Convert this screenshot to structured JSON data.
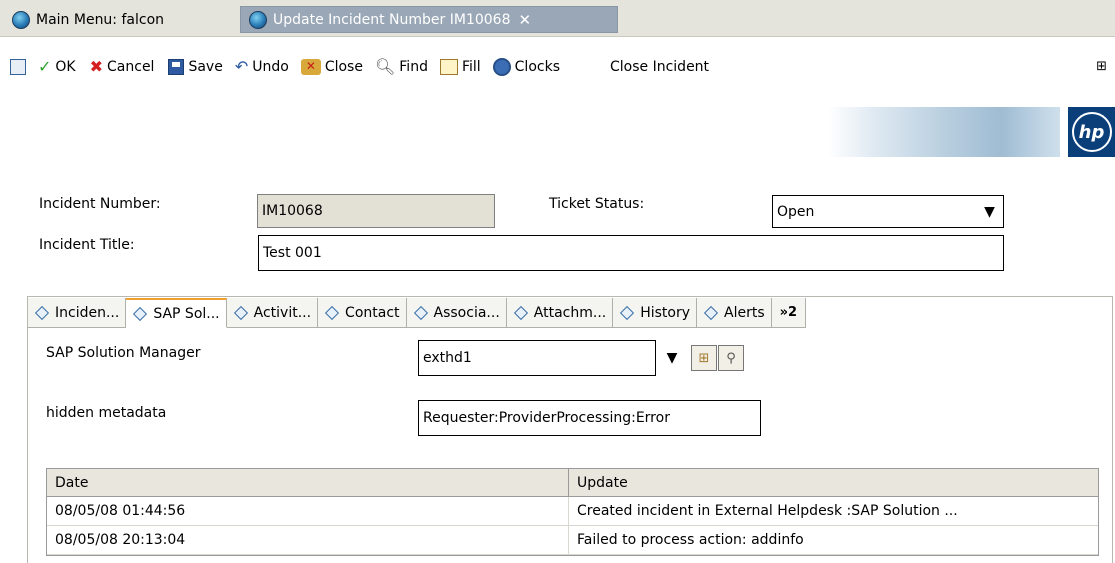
{
  "window_tabs": [
    {
      "label": "Main Menu: falcon"
    },
    {
      "label": "Update Incident Number IM10068",
      "close": "✕"
    }
  ],
  "toolbar": {
    "ok": "OK",
    "cancel": "Cancel",
    "save": "Save",
    "undo": "Undo",
    "close": "Close",
    "find": "Find",
    "fill": "Fill",
    "clocks": "Clocks",
    "close_incident": "Close Incident"
  },
  "form": {
    "incident_number_label": "Incident Number:",
    "incident_number_value": "IM10068",
    "ticket_status_label": "Ticket Status:",
    "ticket_status_value": "Open",
    "incident_title_label": "Incident Title:",
    "incident_title_value": "Test 001"
  },
  "inner_tabs": [
    {
      "label": "Inciden..."
    },
    {
      "label": "SAP Sol..."
    },
    {
      "label": "Activit..."
    },
    {
      "label": "Contact"
    },
    {
      "label": "Associa..."
    },
    {
      "label": "Attachm..."
    },
    {
      "label": "History"
    },
    {
      "label": "Alerts"
    },
    {
      "label": "»2"
    }
  ],
  "sap_panel": {
    "solution_manager_label": "SAP Solution Manager",
    "solution_manager_value": "exthd1",
    "hidden_metadata_label": "hidden metadata",
    "hidden_metadata_value": "Requester:ProviderProcessing:Error"
  },
  "table": {
    "headers": [
      "Date",
      "Update"
    ],
    "rows": [
      [
        "08/05/08 01:44:56",
        "Created incident in External Helpdesk :SAP Solution ..."
      ],
      [
        "08/05/08 20:13:04",
        "Failed to process action: addinfo"
      ]
    ]
  },
  "icons": {
    "ok": "check-icon",
    "cancel": "x-icon",
    "save": "floppy-icon",
    "undo": "undo-icon",
    "find": "magnifier-icon",
    "clocks": "clock-icon"
  }
}
